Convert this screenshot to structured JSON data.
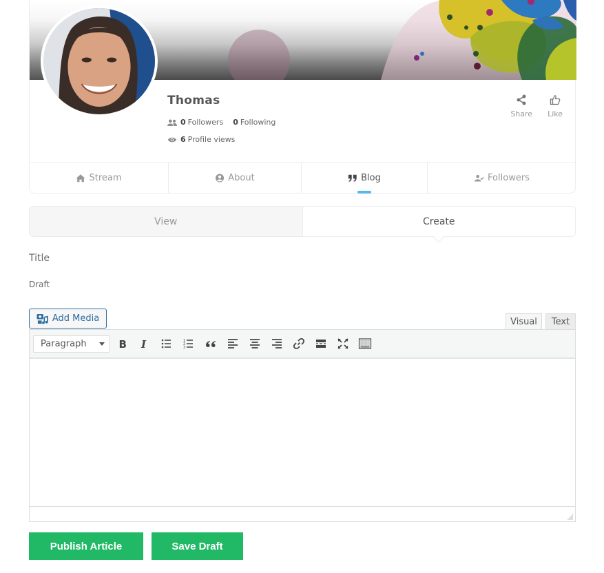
{
  "profile": {
    "name": "Thomas",
    "followers_count": "0",
    "followers_label": "Followers",
    "following_count": "0",
    "following_label": "Following",
    "views_count": "6",
    "views_label": "Profile views",
    "actions": [
      {
        "label": "Share",
        "icon": "share-icon"
      },
      {
        "label": "Like",
        "icon": "thumbs-up-icon"
      }
    ]
  },
  "profile_tabs": [
    {
      "label": "Stream",
      "icon": "home-icon",
      "active": false
    },
    {
      "label": "About",
      "icon": "user-circle-icon",
      "active": false
    },
    {
      "label": "Blog",
      "icon": "quote-icon",
      "active": true
    },
    {
      "label": "Followers",
      "icon": "user-check-icon",
      "active": false
    }
  ],
  "blog_tabs": {
    "view_label": "View",
    "create_label": "Create",
    "active": "Create"
  },
  "form": {
    "title_label": "Title",
    "draft_label": "Draft",
    "add_media_label": "Add Media",
    "visual_tab": "Visual",
    "text_tab": "Text",
    "format_select": "Paragraph",
    "editor_content": ""
  },
  "toolbar_buttons": [
    "bold",
    "italic",
    "bulleted-list",
    "numbered-list",
    "blockquote",
    "align-left",
    "align-center",
    "align-right",
    "insert-link",
    "read-more",
    "fullscreen",
    "toolbar-toggle"
  ],
  "buttons": {
    "publish": "Publish Article",
    "save_draft": "Save Draft"
  },
  "colors": {
    "accent_green": "#22b966",
    "tab_indicator": "#5ab4ee",
    "media_blue": "#2e6f9e"
  }
}
